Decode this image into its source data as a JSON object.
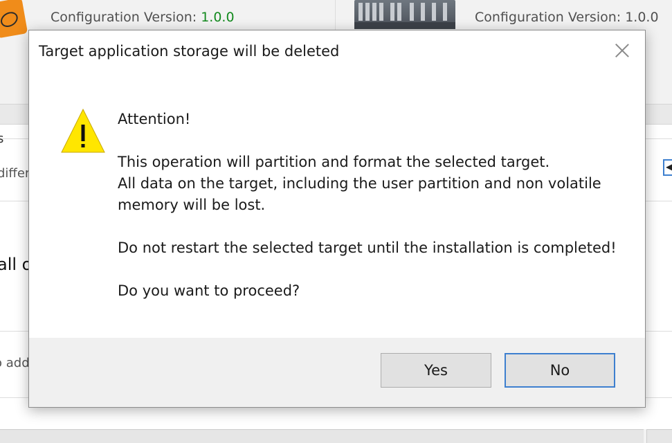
{
  "background": {
    "left_panel": {
      "config_label": "Configuration Version:",
      "config_value": "1.0.0"
    },
    "right_panel": {
      "config_label": "Configuration Version:",
      "config_value": "1.0.0"
    },
    "fragments": {
      "s": "s",
      "differ": "differ",
      "all_o": "all o",
      "o_add": "o add"
    }
  },
  "dialog": {
    "title": "Target application storage will be deleted",
    "icon": "warning-icon",
    "lines": {
      "attention": "Attention!",
      "op1": "This operation will partition and format the selected target.",
      "op2": "All data on the target, including the user partition and non volatile",
      "op3": "memory will be lost.",
      "restart": "Do not restart the selected target until the installation is completed!",
      "proceed": "Do you want to proceed?"
    },
    "buttons": {
      "yes": "Yes",
      "no": "No"
    }
  },
  "colors": {
    "accent": "#3d7fcf",
    "version_green": "#138a1e",
    "warning_yellow": "#ffe600",
    "brand_orange": "#f08c1a"
  }
}
